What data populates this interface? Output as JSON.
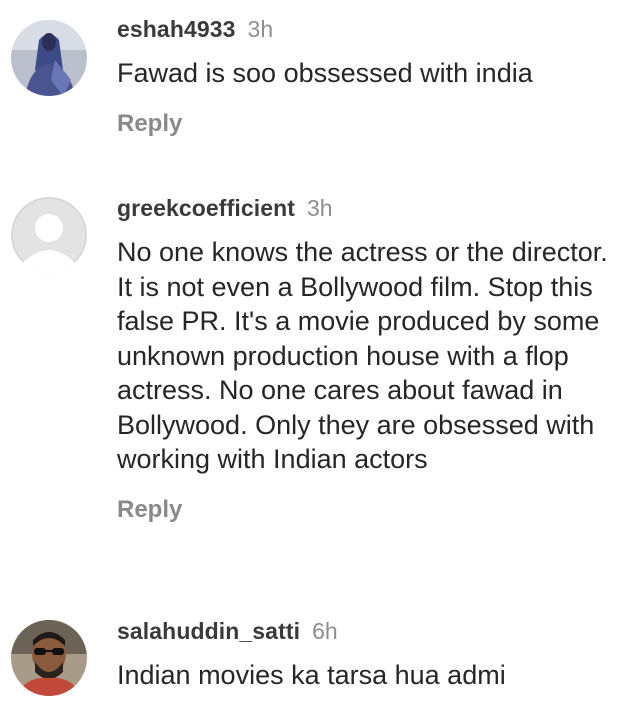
{
  "comments": [
    {
      "username": "eshah4933",
      "time": "3h",
      "text": "Fawad is soo obssessed with india",
      "reply_label": "Reply",
      "avatar": "profile-photo-icon"
    },
    {
      "username": "greekcoefficient",
      "time": "3h",
      "text": "No one knows the actress or the director. It is not even a Bollywood film. Stop this false PR. It's a movie produced by some unknown production house with a flop actress. No one cares about fawad in Bollywood. Only they are obsessed with working with Indian actors",
      "reply_label": "Reply",
      "avatar": "default-avatar-icon"
    },
    {
      "username": "salahuddin_satti",
      "time": "6h",
      "text": "Indian movies ka tarsa hua admi",
      "avatar": "profile-photo-icon"
    }
  ],
  "colors": {
    "text": "#262626",
    "username": "#3a3a3a",
    "muted": "#8e8e8e",
    "reply": "#8a8a8a"
  }
}
